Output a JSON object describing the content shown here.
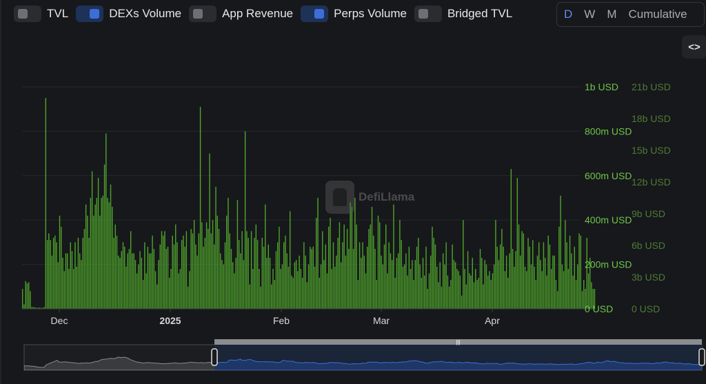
{
  "toggles": [
    {
      "label": "TVL",
      "on": false
    },
    {
      "label": "DEXs Volume",
      "on": true
    },
    {
      "label": "App Revenue",
      "on": false
    },
    {
      "label": "Perps Volume",
      "on": true
    },
    {
      "label": "Bridged TVL",
      "on": false
    }
  ],
  "period": {
    "options": [
      "D",
      "W",
      "M",
      "Cumulative"
    ],
    "selected": "D"
  },
  "embed": {
    "icon": "code-icon",
    "label": "<>"
  },
  "watermark": {
    "text": "DefiLlama"
  },
  "colors": {
    "bars": "#4fa52c",
    "axis_left": "#6ec54a",
    "axis_right": "#4e7a36",
    "brush": "#3d6ed8"
  },
  "chart_data": {
    "type": "bar",
    "title": "",
    "y_left": {
      "unit": "USD",
      "ticks": [
        "0 USD",
        "200m USD",
        "400m USD",
        "600m USD",
        "800m USD",
        "1b USD"
      ],
      "ylim": [
        0,
        1000000000
      ]
    },
    "y_right": {
      "ticks": [
        "0 USD",
        "3b USD",
        "6b USD",
        "9b USD",
        "12b USD",
        "15b USD",
        "18b USD",
        "21b USD"
      ],
      "ylim": [
        0,
        21000000000
      ]
    },
    "x_ticks": [
      {
        "label": "Dec",
        "bold": false
      },
      {
        "label": "2025",
        "bold": true
      },
      {
        "label": "Feb",
        "bold": false
      },
      {
        "label": "Mar",
        "bold": false
      },
      {
        "label": "Apr",
        "bold": false
      }
    ],
    "series": [
      {
        "values": [
          90,
          20,
          125,
          115,
          120,
          80,
          8,
          8,
          7,
          5,
          5,
          6,
          5,
          4,
          8,
          950,
          310,
          340,
          310,
          240,
          320,
          330,
          300,
          210,
          420,
          370,
          230,
          170,
          250,
          250,
          180,
          300,
          260,
          180,
          300,
          190,
          320,
          250,
          220,
          320,
          360,
          470,
          420,
          320,
          500,
          620,
          420,
          470,
          500,
          590,
          420,
          500,
          510,
          650,
          790,
          500,
          480,
          560,
          460,
          320,
          380,
          330,
          240,
          230,
          260,
          300,
          280,
          190,
          250,
          270,
          350,
          250,
          250,
          220,
          160,
          200,
          260,
          230,
          130,
          300,
          160,
          280,
          250,
          250,
          330,
          270,
          170,
          110,
          220,
          290,
          350,
          330,
          350,
          270,
          280,
          140,
          180,
          330,
          290,
          380,
          300,
          160,
          180,
          310,
          330,
          280,
          350,
          100,
          170,
          360,
          340,
          400,
          290,
          240,
          340,
          910,
          390,
          280,
          320,
          390,
          360,
          700,
          340,
          400,
          290,
          550,
          420,
          360,
          250,
          220,
          200,
          300,
          420,
          500,
          340,
          270,
          210,
          160,
          230,
          490,
          310,
          250,
          350,
          220,
          800,
          350,
          320,
          110,
          350,
          180,
          320,
          380,
          310,
          180,
          100,
          320,
          280,
          470,
          230,
          290,
          230,
          110,
          180,
          130,
          260,
          300,
          370,
          180,
          200,
          300,
          330,
          250,
          190,
          440,
          150,
          140,
          210,
          220,
          170,
          240,
          180,
          140,
          300,
          240,
          120,
          200,
          280,
          270,
          280,
          190,
          410,
          500,
          140,
          200,
          350,
          220,
          290,
          160,
          370,
          410,
          180,
          300,
          190,
          240,
          320,
          390,
          210,
          300,
          380,
          240,
          360,
          270,
          480,
          460,
          270,
          500,
          380,
          130,
          300,
          230,
          300,
          240,
          160,
          280,
          360,
          380,
          460,
          330,
          270,
          130,
          420,
          390,
          240,
          200,
          290,
          380,
          160,
          300,
          250,
          220,
          470,
          140,
          230,
          250,
          400,
          310,
          190,
          200,
          250,
          150,
          280,
          180,
          220,
          130,
          220,
          280,
          320,
          200,
          140,
          230,
          150,
          280,
          90,
          160,
          240,
          370,
          320,
          290,
          190,
          120,
          210,
          100,
          250,
          200,
          300,
          150,
          100,
          130,
          290,
          220,
          210,
          180,
          170,
          150,
          60,
          400,
          180,
          110,
          260,
          160,
          150,
          230,
          120,
          180,
          130,
          140,
          270,
          230,
          110,
          220,
          200,
          150,
          170,
          130,
          160,
          200,
          400,
          280,
          220,
          290,
          360,
          280,
          170,
          240,
          140,
          250,
          630,
          270,
          190,
          260,
          590,
          380,
          240,
          350,
          340,
          190,
          170,
          320,
          280,
          200,
          310,
          190,
          130,
          240,
          300,
          220,
          170,
          300,
          230,
          150,
          330,
          290,
          180,
          240,
          240,
          130,
          80,
          370,
          510,
          200,
          170,
          400,
          300,
          180,
          330,
          250,
          150,
          280,
          130,
          200,
          340,
          330,
          80,
          130,
          90,
          320,
          160,
          230,
          120,
          90,
          90
        ]
      }
    ]
  }
}
